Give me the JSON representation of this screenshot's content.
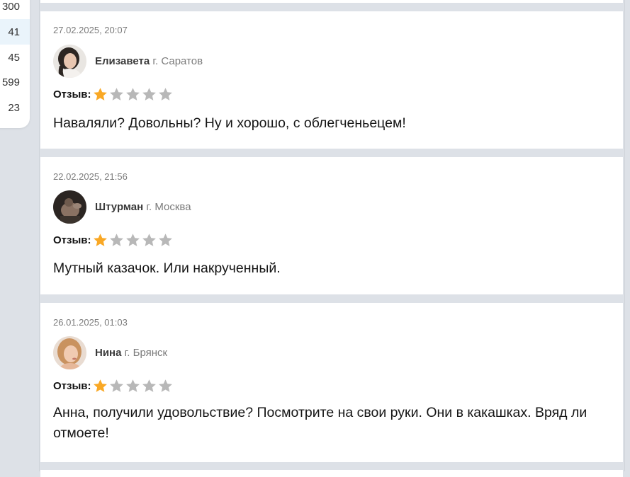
{
  "sidebar": {
    "counts": [
      {
        "value": "300",
        "active": false
      },
      {
        "value": "41",
        "active": true
      },
      {
        "value": "45",
        "active": false
      },
      {
        "value": "599",
        "active": false
      },
      {
        "value": "23",
        "active": false
      }
    ]
  },
  "colors": {
    "star_active": "#f9a825",
    "star_inactive": "#b8b8b8",
    "page_background": "#dde1e7",
    "active_row": "#eaf4fb"
  },
  "rating_label": "Отзыв:",
  "rating_max": 5,
  "reviews": [
    {
      "date": "27.02.2025, 20:07",
      "name": "Елизавета",
      "city": "г. Саратов",
      "rating": 1,
      "text": "Наваляли? Довольны? Ну и хорошо, с облегченьецем!",
      "avatar_icon": "woman-dark-hair-avatar"
    },
    {
      "date": "22.02.2025, 21:56",
      "name": "Штурман",
      "city": "г. Москва",
      "rating": 1,
      "text": "Мутный казачок. Или накрученный.",
      "avatar_icon": "man-dark-photo-avatar"
    },
    {
      "date": "26.01.2025, 01:03",
      "name": "Нина",
      "city": "г. Брянск",
      "rating": 1,
      "text": "Анна, получили удовольствие? Посмотрите на свои руки. Они в какашках. Вряд ли отмоете!",
      "avatar_icon": "woman-blonde-avatar"
    }
  ]
}
